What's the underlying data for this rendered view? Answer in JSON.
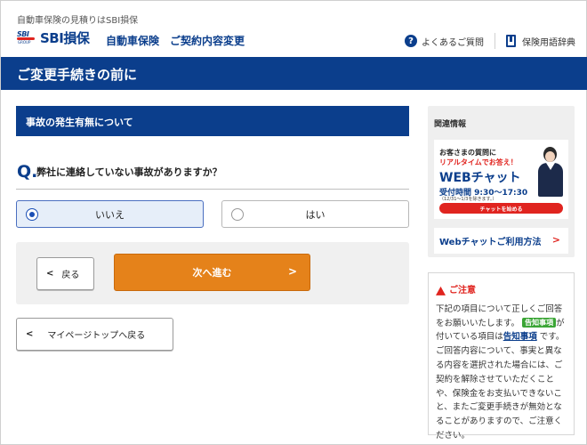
{
  "header": {
    "tagline": "自動車保険の見積りはSBI損保",
    "logo_mark": "SBI",
    "logo_group": "GROUP",
    "logo_text": "SBI損保",
    "product": "自動車保険　ご契約内容変更",
    "faq_label": "よくあるご質問",
    "glossary_label": "保険用語辞典"
  },
  "page_title": "ご変更手続きの前に",
  "section": {
    "heading": "事故の発生有無について",
    "q_label": "Q.",
    "question": "弊社に連絡していない事故がありますか？",
    "options": [
      {
        "label": "いいえ",
        "selected": true
      },
      {
        "label": "はい",
        "selected": false
      }
    ]
  },
  "nav": {
    "back_label": "戻る",
    "next_label": "次へ進む",
    "mypage_label": "マイページトップへ戻る"
  },
  "sidebar": {
    "related_label": "関連情報",
    "banner": {
      "line1": "お客さまの質問に",
      "line2": "リアルタイムでお答え！",
      "title": "WEBチャット",
      "hours": "受付時間 9:30～17:30",
      "note": "（12/31～1/3を除きます。）",
      "button": "チャットを始める"
    },
    "webchat_link": "Webチャットご利用方法",
    "notice": {
      "heading": "ご注意",
      "text1": "下記の項目について正しくご回答をお願いいたします。",
      "badge": "告知事項",
      "text2": "が付いている項目は",
      "link": "告知事項",
      "text3": "です。ご回答内容について、事実と異なる内容を選択された場合には、ご契約を解除させていただくことや、保険金をお支払いできないこと、またご変更手続きが無効となることがありますので、ご注意ください。"
    }
  },
  "colors": {
    "brand_blue": "#0b3e8c",
    "accent_orange": "#e5821a",
    "alert_red": "#e0241f",
    "badge_green": "#3aa535"
  }
}
